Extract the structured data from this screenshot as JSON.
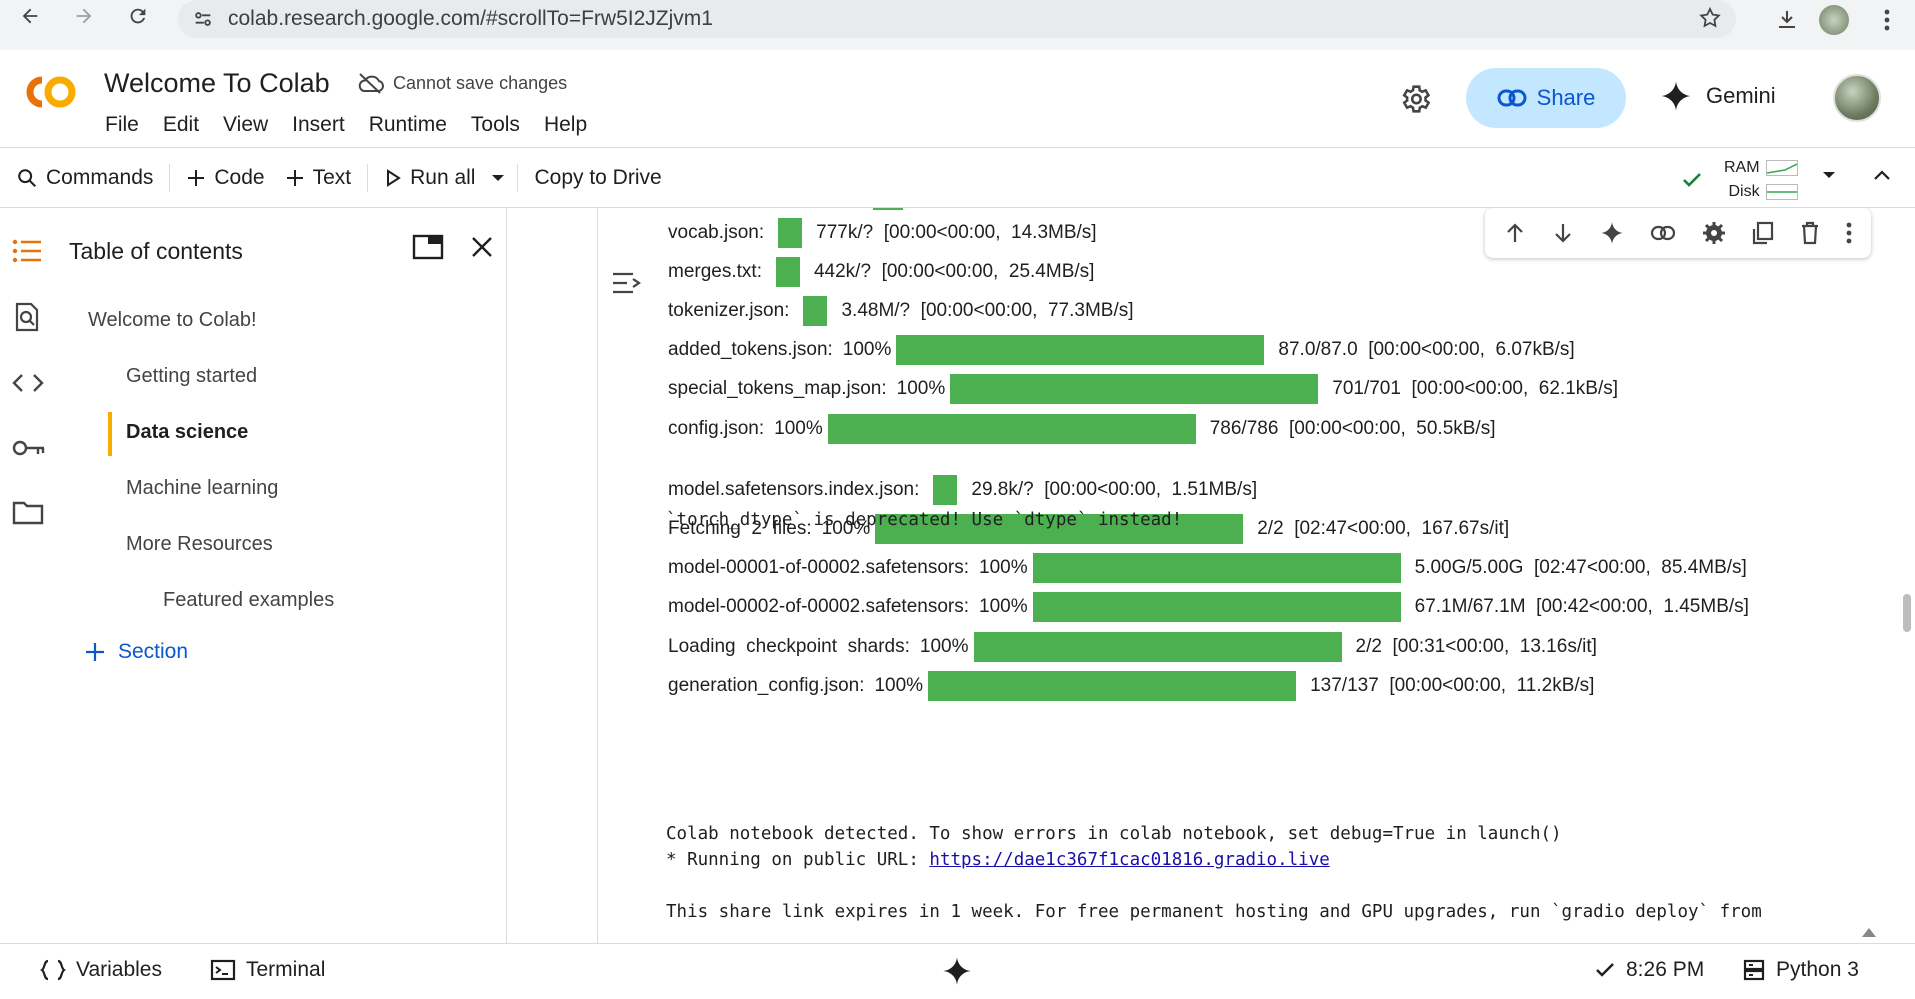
{
  "browser": {
    "url": "colab.research.google.com/#scrollTo=Frw5I2JZjvm1"
  },
  "header": {
    "title": "Welcome To Colab",
    "save_state": "Cannot save changes",
    "menu": [
      "File",
      "Edit",
      "View",
      "Insert",
      "Runtime",
      "Tools",
      "Help"
    ],
    "share_label": "Share",
    "gemini_label": "Gemini"
  },
  "toolbar": {
    "commands": "Commands",
    "code": "Code",
    "text": "Text",
    "run_all": "Run all",
    "copy_to_drive": "Copy to Drive",
    "ram_label": "RAM",
    "disk_label": "Disk"
  },
  "toc": {
    "title": "Table of contents",
    "items": [
      {
        "label": "Welcome to Colab!",
        "level": 1
      },
      {
        "label": "Getting started",
        "level": 2
      },
      {
        "label": "Data science",
        "level": 2,
        "active": true
      },
      {
        "label": "Machine learning",
        "level": 2
      },
      {
        "label": "More Resources",
        "level": 2
      },
      {
        "label": "Featured examples",
        "level": 3
      }
    ],
    "add_section": "Section"
  },
  "output": {
    "progress_rows": [
      {
        "label": "vocab.json:",
        "pct": "",
        "stats": "777k/?  [00:00<00:00,  14.3MB/s]",
        "fill": 0.065
      },
      {
        "label": "merges.txt:",
        "pct": "",
        "stats": "442k/?  [00:00<00:00,  25.4MB/s]",
        "fill": 0.065
      },
      {
        "label": "tokenizer.json:",
        "pct": "",
        "stats": "3.48M/?  [00:00<00:00,  77.3MB/s]",
        "fill": 0.065
      },
      {
        "label": "added_tokens.json:",
        "pct": "100%",
        "stats": "87.0/87.0  [00:00<00:00,  6.07kB/s]",
        "fill": 1.0
      },
      {
        "label": "special_tokens_map.json:",
        "pct": "100%",
        "stats": "701/701  [00:00<00:00,  62.1kB/s]",
        "fill": 1.0
      },
      {
        "label": "config.json:",
        "pct": "100%",
        "stats": "786/786  [00:00<00:00,  50.5kB/s]",
        "fill": 1.0
      },
      {
        "label": "model.safetensors.index.json:",
        "pct": "",
        "stats": "29.8k/?  [00:00<00:00,  1.51MB/s]",
        "fill": 0.065
      },
      {
        "label": "Fetching  2  files:",
        "pct": "100%",
        "stats": "2/2  [02:47<00:00,  167.67s/it]",
        "fill": 1.0
      },
      {
        "label": "model-00001-of-00002.safetensors:",
        "pct": "100%",
        "stats": "5.00G/5.00G  [02:47<00:00,  85.4MB/s]",
        "fill": 1.0
      },
      {
        "label": "model-00002-of-00002.safetensors:",
        "pct": "100%",
        "stats": "67.1M/67.1M  [00:42<00:00,  1.45MB/s]",
        "fill": 1.0
      },
      {
        "label": "Loading  checkpoint  shards:",
        "pct": "100%",
        "stats": "2/2  [00:31<00:00,  13.16s/it]",
        "fill": 1.0
      },
      {
        "label": "generation_config.json:",
        "pct": "100%",
        "stats": "137/137  [00:00<00:00,  11.2kB/s]",
        "fill": 1.0
      }
    ],
    "deprecation_warning": "`torch_dtype` is deprecated! Use `dtype` instead!",
    "colab_detected": "Colab notebook detected. To show errors in colab notebook, set debug=True in launch()",
    "running_prefix": "* Running on public URL: ",
    "public_url": "https://dae1c367f1cac01816.gradio.live",
    "share_notice": "This share link expires in 1 week. For free permanent hosting and GPU upgrades, run `gradio deploy` from"
  },
  "statusbar": {
    "variables": "Variables",
    "terminal": "Terminal",
    "time": "8:26 PM",
    "runtime": "Python 3"
  },
  "colors": {
    "progress_green": "#4caf50",
    "share_bg": "#c2e7ff",
    "accent_blue": "#0b57d0",
    "toc_active_bar": "#f9ab00",
    "colab_orange": "#f9ab00"
  }
}
